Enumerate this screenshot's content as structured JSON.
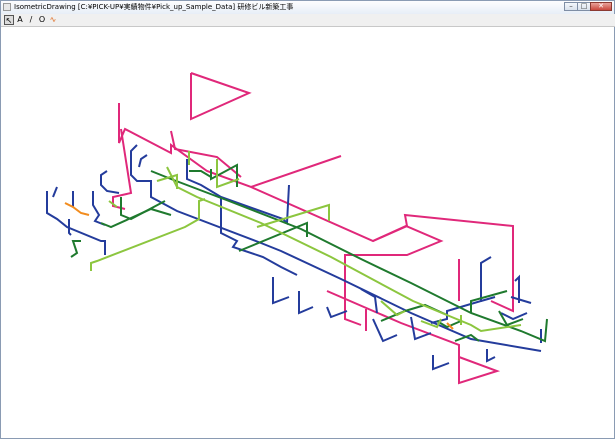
{
  "window": {
    "title": "IsometricDrawing [C:¥PICK-UP¥実績物件¥Pick_up_Sample_Data]   研修ビル新築工事",
    "controls": {
      "minimize": "–",
      "maximize": "□",
      "close": "✕"
    }
  },
  "toolbar": {
    "tools": [
      {
        "name": "pointer-tool",
        "icon": "arrow-cursor-icon",
        "glyph": "↖",
        "selected": true
      },
      {
        "name": "text-tool",
        "icon": "text-icon",
        "glyph": "A",
        "selected": false
      },
      {
        "name": "line-tool",
        "icon": "line-icon",
        "glyph": "/",
        "selected": false
      },
      {
        "name": "circle-tool",
        "icon": "circle-icon",
        "glyph": "O",
        "selected": false
      },
      {
        "name": "pipe-tool",
        "icon": "pipe-icon",
        "glyph": "∿",
        "selected": false
      }
    ]
  },
  "colors": {
    "blue": "#243c9c",
    "magenta": "#e0287a",
    "green": "#1f7a2e",
    "lightgreen": "#8cc63f",
    "orange": "#f28c1e"
  }
}
